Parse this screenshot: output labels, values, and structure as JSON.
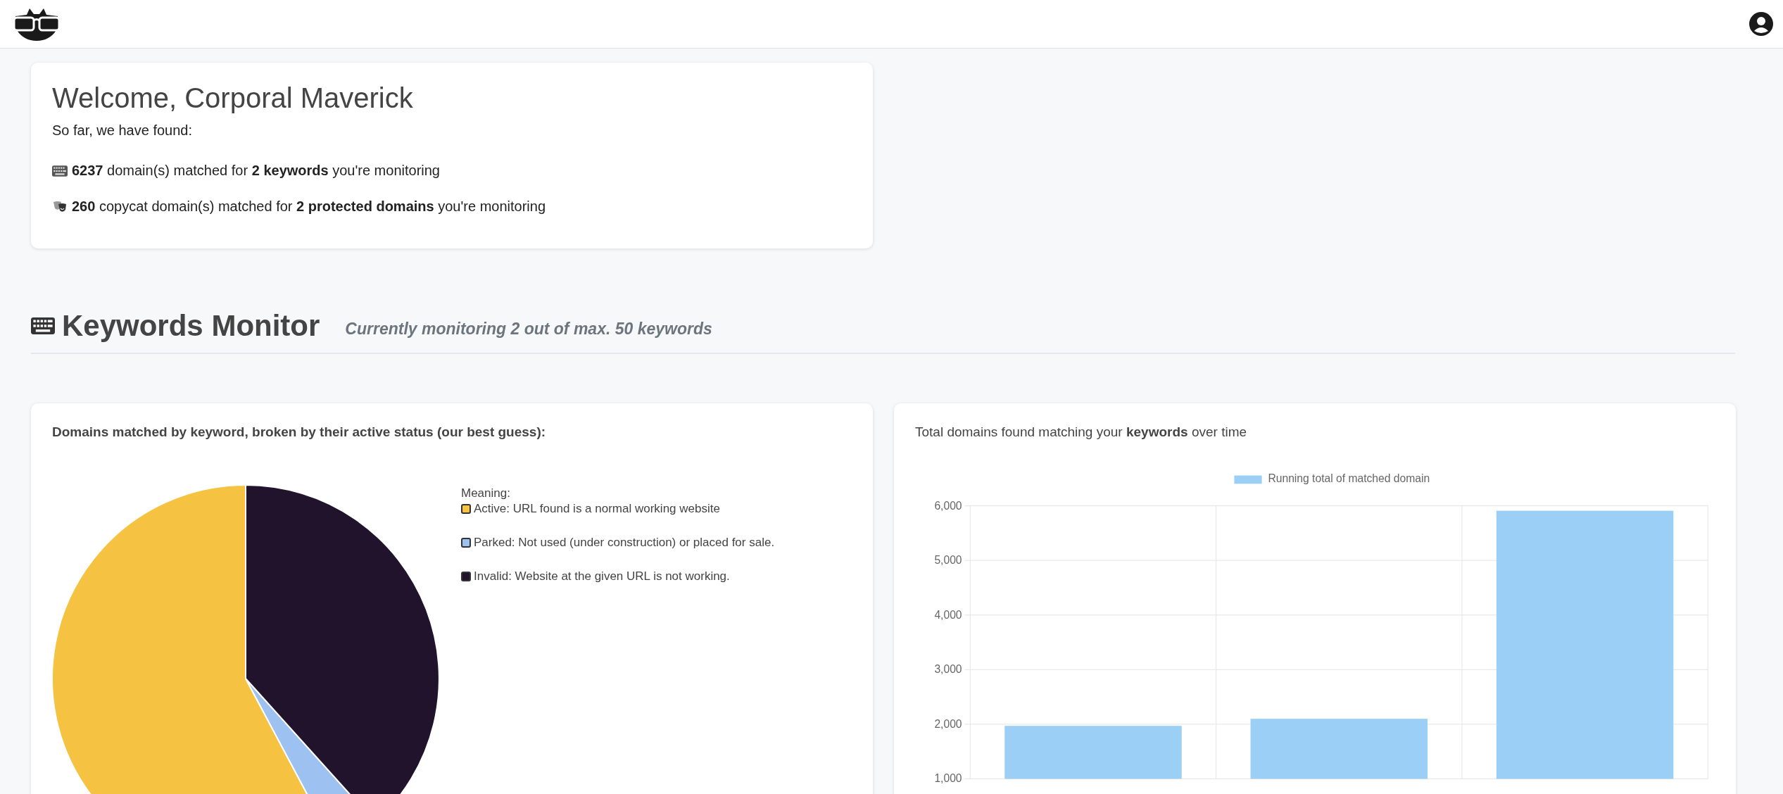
{
  "welcome": {
    "title": "Welcome, Corporal Maverick",
    "intro": "So far, we have found:",
    "lines": [
      {
        "kind": "keywords",
        "text": "**6237** domain(s) matched for **2 keywords** you're monitoring"
      },
      {
        "kind": "copycat",
        "text": "**260** copycat domain(s) matched for **2 protected domains** you're monitoring"
      }
    ]
  },
  "keywords_monitor": {
    "title": "Keywords Monitor",
    "subtitle": "Currently monitoring 2 out of max. 50 keywords",
    "status_card": {
      "title": "Domains matched by keyword, broken by their active status (our best guess):",
      "legend_title": "Meaning:",
      "legend": [
        {
          "label": "Active: URL found is a normal working website",
          "color": "#f5c242"
        },
        {
          "label": "Parked: Not used (under construction) or placed for sale.",
          "color": "#9dc1f0"
        },
        {
          "label": "Invalid: Website at the given URL is not working.",
          "color": "#21132c"
        }
      ]
    },
    "trend_card": {
      "title": "Total domains found matching your **keywords** over time",
      "chart_data": {
        "type": "bar",
        "grid": true,
        "series": [
          {
            "name": "Running total of matched domain",
            "color": "#9bcff5",
            "values": [
              1970,
              2100,
              5910
            ]
          }
        ],
        "ylim": [
          1000,
          6000
        ],
        "yticks": [
          {
            "value": 1000,
            "label": "1,000"
          },
          {
            "value": 2000,
            "label": "2,000"
          },
          {
            "value": 3000,
            "label": "3,000"
          },
          {
            "value": 4000,
            "label": "4,000"
          },
          {
            "value": 5000,
            "label": "5,000"
          },
          {
            "value": 6000,
            "label": "6,000"
          }
        ]
      }
    }
  }
}
